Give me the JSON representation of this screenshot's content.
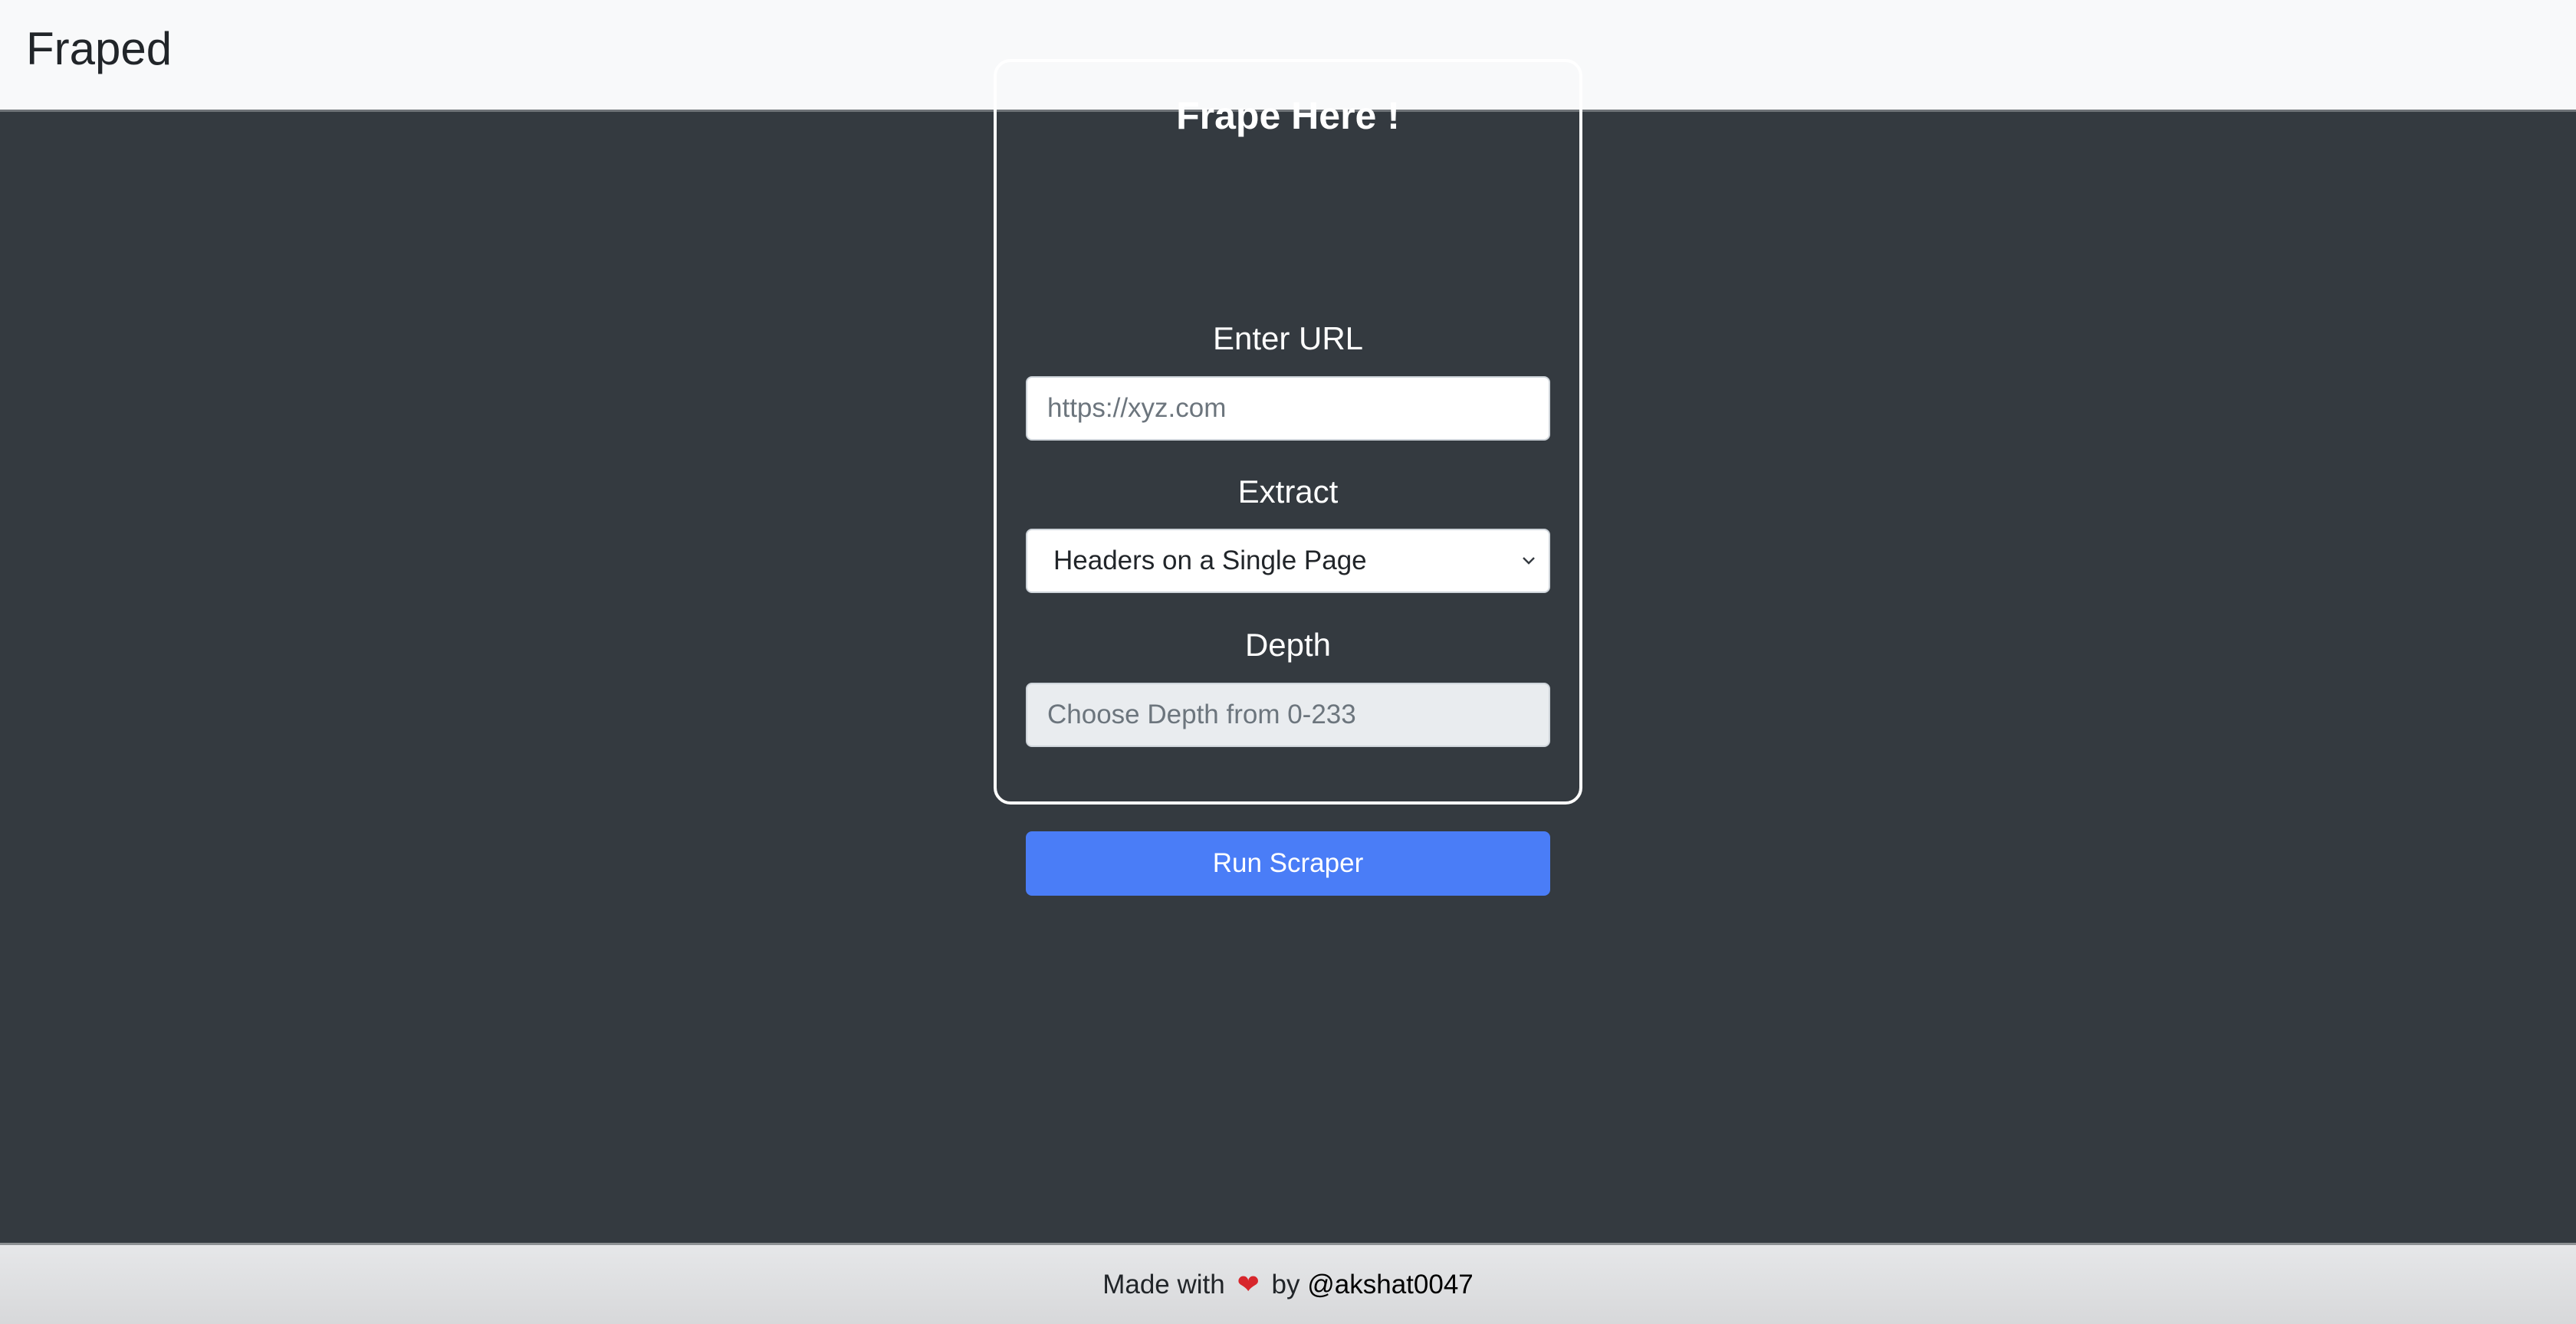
{
  "navbar": {
    "brand": "Fraped"
  },
  "form": {
    "title": "Frape Here !",
    "url_label": "Enter URL",
    "url_placeholder": "https://xyz.com",
    "url_value": "",
    "extract_label": "Extract",
    "extract_selected": "Headers on a Single Page",
    "depth_label": "Depth",
    "depth_placeholder": "Choose Depth from 0-233",
    "depth_value": "",
    "submit_label": "Run Scraper"
  },
  "footer": {
    "made_with": "Made with",
    "heart": "❤",
    "by": "by",
    "handle": "@akshat0047"
  },
  "colors": {
    "page_bg": "#343a40",
    "navbar_bg": "#f8f9fa",
    "button_bg": "#4a7df7",
    "heart": "#d7262c"
  },
  "icons": {
    "select_arrow": "chevron-down-icon",
    "footer_heart": "heart-icon"
  }
}
